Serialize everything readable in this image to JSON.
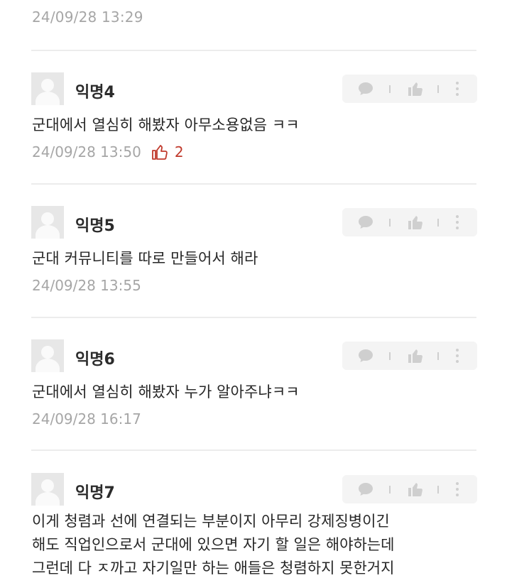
{
  "top_timestamp": "24/09/28 13:29",
  "comments": [
    {
      "author": "익명4",
      "text": "군대에서 열심히 해봤자 아무소용없음 ㅋㅋ",
      "timestamp": "24/09/28 13:50",
      "likes": "2"
    },
    {
      "author": "익명5",
      "text": "군대 커뮤니티를 따로 만들어서 해라",
      "timestamp": "24/09/28 13:55"
    },
    {
      "author": "익명6",
      "text": "군대에서 열심히 해봤자 누가 알아주냐ㅋㅋ",
      "timestamp": "24/09/28 16:17"
    },
    {
      "author": "익명7",
      "lines": [
        "이게 청렴과 선에 연결되는 부분이지 아무리 강제징병이긴",
        "해도 직업인으로서 군대에 있으면 자기 할 일은 해야하는데",
        "그런데 다 ㅈ까고 자기일만 하는 애들은 청렴하지 못한거지"
      ]
    }
  ],
  "icons": {
    "reply": "speech-bubble-icon",
    "like": "thumbs-up-icon",
    "more": "vertical-dots-icon",
    "like_count": "thumbs-up-outline-icon"
  },
  "colors": {
    "like_accent": "#c0392b",
    "muted_text": "#a6a6a6",
    "action_bg": "#f4f4f4"
  }
}
